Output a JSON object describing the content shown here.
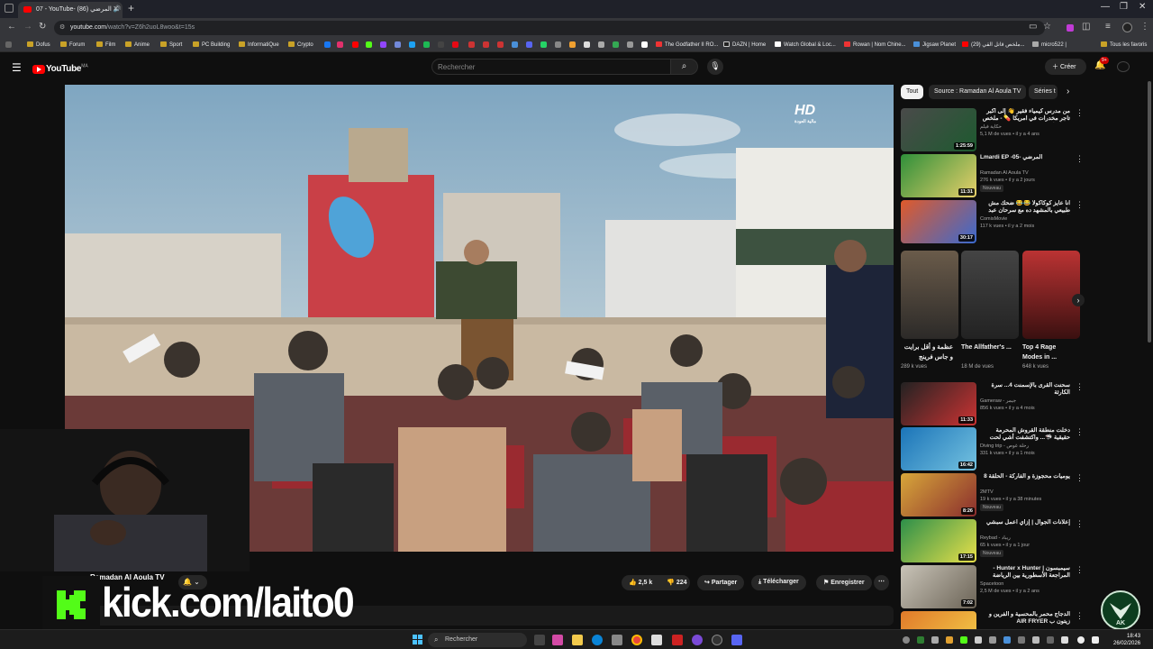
{
  "browser": {
    "tab_title": "07 - YouTube- المرضي (86) 🔊",
    "url_host": "youtube.com",
    "url_rest": "/watch?v=Z6h2uoL8woo&t=15s",
    "bookmarks": [
      "Dofus",
      "Forum",
      "Film",
      "Anime",
      "Sport",
      "PC Building",
      "InformatiQue",
      "Crypto"
    ],
    "bookmarks_right": [
      "The Godfather II RO...",
      "DAZN | Home",
      "Watch Global & Loc...",
      "Rowan | Nom Chine...",
      "Jigsaw Planet",
      "(29) ملخص قاتل القي...",
      "micro522 |"
    ],
    "all_bookmarks": "Tous les favoris"
  },
  "youtube": {
    "logo_text": "YouTube",
    "logo_region": "MA",
    "search_placeholder": "Rechercher",
    "create_label": "Créer",
    "notif_count": "9+"
  },
  "video": {
    "channel_overlay": "HD",
    "channel_overlay_sub": "مالية العودة"
  },
  "below_video": {
    "channel_name": "Ramadan Al Aoula TV",
    "likes": "2,5 k",
    "dislikes": "224",
    "share": "Partager",
    "download": "Télécharger",
    "save": "Enregistrer"
  },
  "stream_overlay": {
    "kick_text": "kick.com/laito0"
  },
  "sidebar": {
    "chips": [
      "Tout",
      "Source : Ramadan Al Aoula TV",
      "Séries t"
    ],
    "recs_top": [
      {
        "title": "من مدرس كيمياء فقير 👋 إلى أكبر تاجر مخدرات في امريكا 💊 - ملخص مسلسل",
        "channel": "حكاية فيلم",
        "meta": "5,1 M de vues • il y a 4 ans",
        "duration": "1:25:59",
        "badge": ""
      },
      {
        "title": "Lmardi  EP -05- المرضي",
        "channel": "Ramadan Al Aoula TV",
        "meta": "276 k vues • il y a 2 jours",
        "duration": "11:31",
        "badge": "Nouveau"
      },
      {
        "title": "انا عايز كوكاكولا 😂😂 ضحك مش طبيعي بالمشهد ده مع سرحان عبد البصير",
        "channel": "ComisMovie",
        "meta": "117 k vues • il y a 2 mois",
        "duration": "30:17",
        "badge": ""
      }
    ],
    "shorts": [
      {
        "title": "عظمة و أقل برايت و جاس فرينج",
        "views": "289 k vues"
      },
      {
        "title": "The Allfather's ...",
        "views": "18 M de vues"
      },
      {
        "title": "Top 4 Rage Modes in ...",
        "views": "648 k vues"
      }
    ],
    "recs_bottom": [
      {
        "title": "سحنت القرى بالإسمنت 4... سرة الكارثة",
        "channel": "Gameraw - جيمر",
        "meta": "856 k vues • il y a 4 mois",
        "duration": "11:33",
        "badge": ""
      },
      {
        "title": "دخلت منطقة القروش المحرمة حقيقية 🦈... واكتشفت أشي لحت بحس...",
        "channel": "Diving trip - رحلة غوص",
        "meta": "331 k vues • il y a 1 mois",
        "duration": "16:42",
        "badge": ""
      },
      {
        "title": "يوميات محجوزة و الفاركة - الحلقة 8",
        "channel": "2MTV",
        "meta": "19 k vues • il y a 38 minutes",
        "duration": "8:26",
        "badge": "Nouveau"
      },
      {
        "title": "إعلانات الجوال | إزاي اعمل سبشي",
        "channel": "Reybad - ريباد",
        "meta": "65 k vues • il y a 1 jour",
        "duration": "17:15",
        "badge": "Nouveau"
      },
      {
        "title": "سيمبسون | Hunter x Hunter - المراجعة الأسطورية بين الرياضة وكيرابا",
        "channel": "Spacetoon",
        "meta": "2,5 M de vues • il y a 2 ans",
        "duration": "7:02",
        "badge": ""
      },
      {
        "title": "الدجاج محمر بالمحسية و الفرين و زيتون ب AIR FRYER",
        "channel": "",
        "meta": "",
        "duration": "",
        "badge": ""
      }
    ]
  },
  "taskbar": {
    "search_label": "Rechercher",
    "time": "18:43",
    "date": "26/02/2026"
  },
  "colors": {
    "yt_red": "#ff0000",
    "kick_green": "#53fc18",
    "bg": "#0f0f0f"
  }
}
